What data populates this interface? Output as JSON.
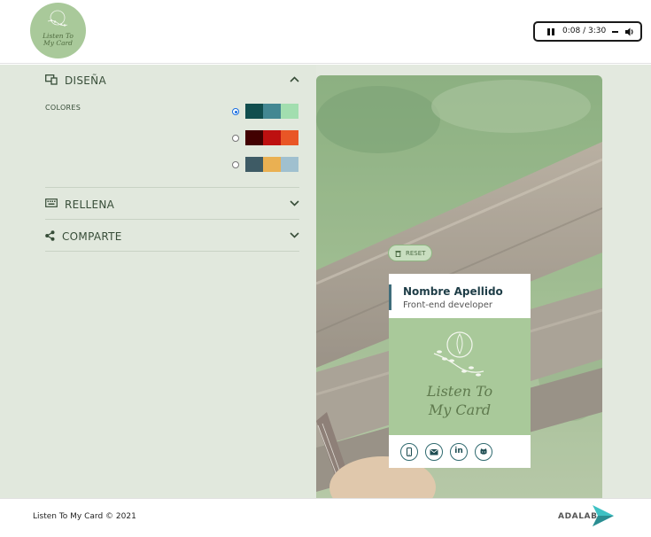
{
  "header": {
    "logo_text_line1": "Listen To",
    "logo_text_line2": "My Card",
    "audio": {
      "time": "0:08 / 3:30"
    }
  },
  "panel": {
    "design": {
      "label": "DISEÑA",
      "colors_label": "COLORES"
    },
    "palettes": [
      {
        "selected": true,
        "colors": [
          "#114e4e",
          "#438792",
          "#a2deaf"
        ]
      },
      {
        "selected": false,
        "colors": [
          "#420101",
          "#bd1010",
          "#e95626"
        ]
      },
      {
        "selected": false,
        "colors": [
          "#3e5b65",
          "#eab052",
          "#a0c0cf"
        ]
      }
    ],
    "fill": {
      "label": "RELLENA"
    },
    "share": {
      "label": "COMPARTE"
    }
  },
  "preview": {
    "reset_label": "RESET",
    "card": {
      "name": "Nombre Apellido",
      "job": "Front-end developer",
      "image_text_line1": "Listen To",
      "image_text_line2": "My Card",
      "social": [
        "phone-icon",
        "email-icon",
        "linkedin-icon",
        "github-icon"
      ]
    }
  },
  "footer": {
    "copyright": "Listen To My Card © 2021",
    "brand": "ADALAB"
  },
  "colors": {
    "accent_green": "#a9c99a",
    "panel_bg": "#e1e8dd",
    "text_dark": "#374d38"
  }
}
